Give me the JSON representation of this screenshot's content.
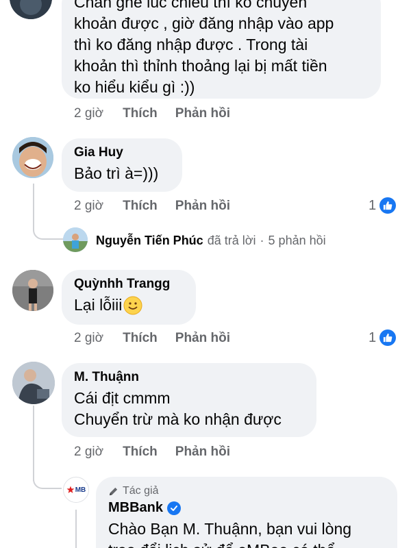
{
  "comments": [
    {
      "text_lines": [
        "Chắn ghế lúc chiều thì ko chuyển",
        "khoản được , giờ đăng nhập vào app",
        "thì ko đăng nhập được . Trong tài",
        "khoản thì thỉnh thoảng lại  bị mất tiền",
        "ko hiểu kiểu gì :))"
      ],
      "time": "2 giờ",
      "like_label": "Thích",
      "reply_label": "Phản hồi"
    },
    {
      "author": "Gia Huy",
      "text_lines": [
        "Bảo trì à=)))"
      ],
      "time": "2 giờ",
      "like_label": "Thích",
      "reply_label": "Phản hồi",
      "reaction_count": "1",
      "reply_summary": {
        "name": "Nguyễn Tiến Phúc",
        "verb": "đã trả lời",
        "separator": "·",
        "count": "5 phản hồi"
      }
    },
    {
      "author": "Quỳnhh Trangg",
      "text_lines": [
        "Lại lỗiii"
      ],
      "time": "2 giờ",
      "like_label": "Thích",
      "reply_label": "Phản hồi",
      "reaction_count": "1"
    },
    {
      "author": "M. Thuậnn",
      "text_lines": [
        "Cái địt cmmm",
        "Chuyển trừ mà ko nhận được"
      ],
      "time": "2 giờ",
      "like_label": "Thích",
      "reply_label": "Phản hồi"
    }
  ],
  "page_reply": {
    "author_tag": "Tác giả",
    "page_name": "MBBank",
    "logo_text": "MB",
    "text_lines": [
      "Chào Bạn M. Thuậnn, bạn vui lòng",
      "trao đổi lịch sử để eMBee có thể"
    ]
  },
  "colors": {
    "bubble": "#f0f2f5",
    "secondary_text": "#65676b",
    "facebook_blue": "#1877f2",
    "mb_logo_red": "#e02020",
    "mb_logo_blue": "#1a3c8c"
  },
  "icons": [
    "like-thumb-icon",
    "smile-emoji-icon",
    "pencil-icon",
    "verified-check-icon",
    "mb-star-icon"
  ]
}
